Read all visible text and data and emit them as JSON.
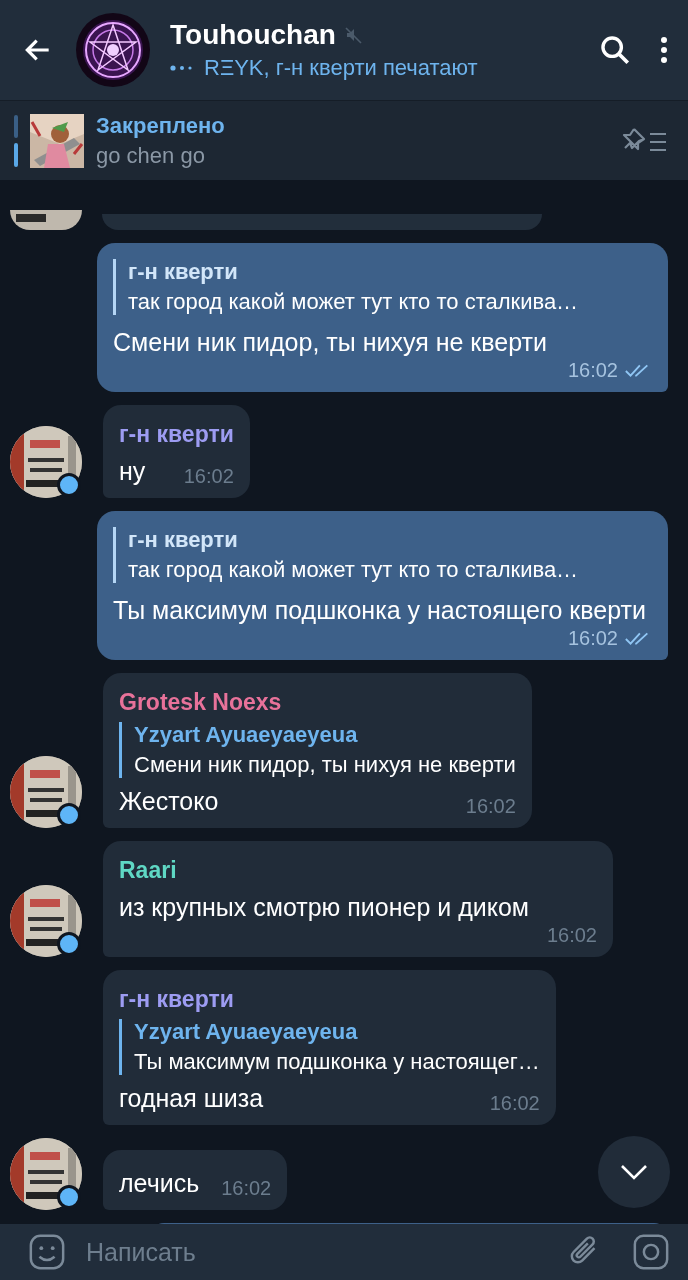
{
  "header": {
    "title": "Touhouchan",
    "muted": true,
    "status": "RΞYK, г-н кверти печатают"
  },
  "pinned": {
    "label": "Закреплено",
    "text": "go chen go"
  },
  "messages": [
    {
      "kind": "outgoing",
      "reply": {
        "author": "г-н кверти",
        "text": "так город какой может тут кто то сталкива…"
      },
      "text": "Смени ник пидор, ты нихуя не кверти",
      "time": "16:02",
      "read": true
    },
    {
      "kind": "incoming",
      "author": "г-н кверти",
      "color": "#9d9cf2",
      "text": "ну",
      "time": "16:02",
      "avatar": true,
      "online": true
    },
    {
      "kind": "outgoing",
      "reply": {
        "author": "г-н кверти",
        "text": "так город какой может тут кто то сталкива…"
      },
      "text": "Ты максимум подшконка у настоящего кверти",
      "time": "16:02",
      "read": true
    },
    {
      "kind": "incoming",
      "author": "Grotesk Noexs",
      "color": "#e8729a",
      "reply": {
        "author": "Yzyart Ayuaeyaeyeua",
        "text": "Смени ник пидор, ты нихуя не кверти"
      },
      "text": "Жестоко",
      "time": "16:02",
      "avatar": true,
      "online": true
    },
    {
      "kind": "incoming",
      "author": "Raari",
      "color": "#5fd8c4",
      "text": "из крупных смотрю пионер и диком",
      "time": "16:02",
      "avatar": true,
      "online": true
    },
    {
      "kind": "incoming",
      "author": "г-н кверти",
      "color": "#9d9cf2",
      "reply": {
        "author": "Yzyart Ayuaeyaeyeua",
        "text": "Ты максимум подшконка у настоящег…"
      },
      "text": "годная шиза",
      "time": "16:02",
      "avatar": false,
      "online": false
    },
    {
      "kind": "incoming",
      "text": "лечись",
      "time": "16:02",
      "avatar": true,
      "online": true
    }
  ],
  "composer": {
    "placeholder": "Написать"
  }
}
